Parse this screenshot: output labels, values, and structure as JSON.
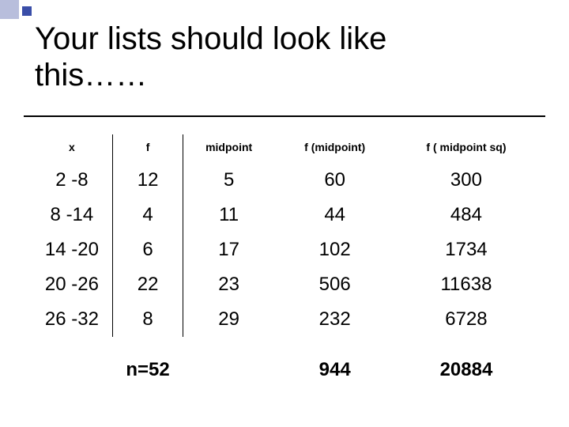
{
  "title": "Your lists should look like\nthis……",
  "columns": {
    "x": "x",
    "f": "f",
    "midpoint": "midpoint",
    "fm": "f (midpoint)",
    "fms": "f ( midpoint sq)"
  },
  "rows": [
    {
      "x": "2 -8",
      "f": "12",
      "mid": "5",
      "fm": "60",
      "fms": "300"
    },
    {
      "x": "8 -14",
      "f": "4",
      "mid": "11",
      "fm": "44",
      "fms": "484"
    },
    {
      "x": "14 -20",
      "f": "6",
      "mid": "17",
      "fm": "102",
      "fms": "1734"
    },
    {
      "x": "20 -26",
      "f": "22",
      "mid": "23",
      "fm": "506",
      "fms": "11638"
    },
    {
      "x": "26 -32",
      "f": "8",
      "mid": "29",
      "fm": "232",
      "fms": "6728"
    }
  ],
  "totals": {
    "n": "n=52",
    "sum_fm": "944",
    "sum_fms": "20884"
  },
  "chart_data": {
    "type": "table",
    "title": "Your lists should look like this……",
    "columns": [
      "x",
      "f",
      "midpoint",
      "f (midpoint)",
      "f ( midpoint sq)"
    ],
    "rows": [
      [
        "2 -8",
        12,
        5,
        60,
        300
      ],
      [
        "8 -14",
        4,
        11,
        44,
        484
      ],
      [
        "14 -20",
        6,
        17,
        102,
        1734
      ],
      [
        "20 -26",
        22,
        23,
        506,
        11638
      ],
      [
        "26 -32",
        8,
        29,
        232,
        6728
      ]
    ],
    "totals": {
      "n": 52,
      "sum_f_midpoint": 944,
      "sum_f_midpoint_sq": 20884
    }
  }
}
